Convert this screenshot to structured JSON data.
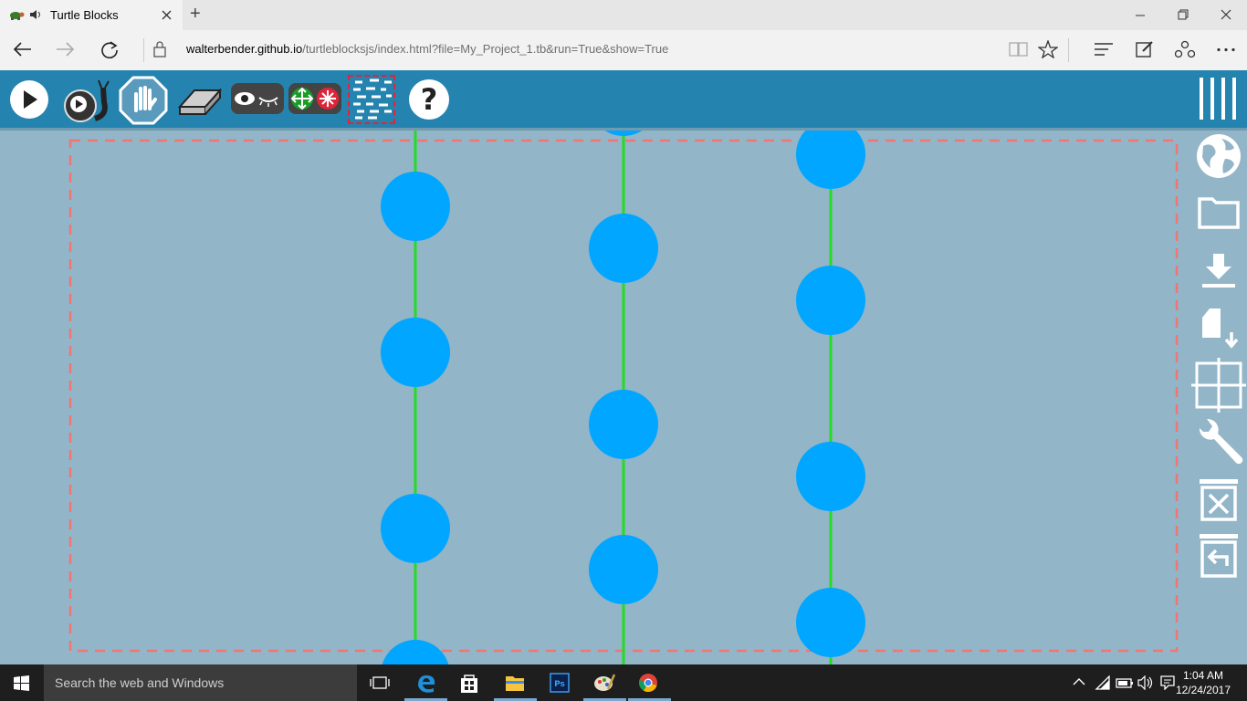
{
  "browser": {
    "tab_title": "Turtle Blocks",
    "new_tab_symbol": "+",
    "address": {
      "host": "walterbender.github.io",
      "path": "/turtleblocksjs/index.html?file=My_Project_1.tb&run=True&show=True"
    }
  },
  "app": {
    "name": "Turtle Blocks",
    "toolbar_left": [
      "run-icon",
      "run-slow-icon",
      "stop-icon",
      "clear-icon",
      "show-hide-blocks-icon",
      "collapse-expand-icon",
      "palette-icon",
      "help-icon"
    ],
    "toolbar_right": [
      "menu-icon"
    ],
    "side_menu": [
      "language-icon",
      "open-file-icon",
      "save-download-icon",
      "load-plugin-icon",
      "grid-icon",
      "settings-wrench-icon",
      "delete-all-icon",
      "restore-trash-icon"
    ],
    "colors": {
      "toolbar": "#2584af",
      "canvas": "#92b5c8",
      "pen_line": "#22dd22",
      "dot_fill": "#00a6ff",
      "boundary": "#f07676"
    }
  },
  "taskbar": {
    "search_placeholder": "Search the web and Windows",
    "time": "1:04 AM",
    "date": "12/24/2017"
  }
}
